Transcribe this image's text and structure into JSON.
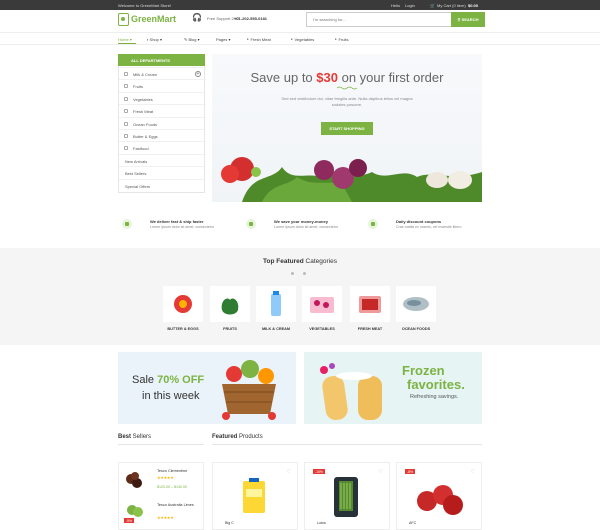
{
  "topbar": {
    "welcome": "Welcome to GreenMart Store!",
    "hello": "Hello",
    "login": "Login",
    "cart": "My Cart (0 item)",
    "cart_total": "$0.00"
  },
  "header": {
    "logo": "GreenMart",
    "support_label": "Free Support 24/7",
    "support_phone": "+01-202-555-0181",
    "search_placeholder": "I'm searching for...",
    "search_button": "SEARCH"
  },
  "nav": {
    "items": [
      "Home ▾",
      "Shop ▾",
      "Blog ▾",
      "Pages ▾",
      "Fresh Meat",
      "Vegetables",
      "Fruits"
    ]
  },
  "sidebar": {
    "header": "ALL DEPARTMENTS",
    "items": [
      "Milk & Cream",
      "Fruits",
      "Vegetables",
      "Fresh Meat",
      "Ocean Foods",
      "Butter & Eggs",
      "Fastfood"
    ],
    "links": [
      "New Arrivals",
      "Best Sellers",
      "Special Offers"
    ]
  },
  "hero": {
    "title_pre": "Save up to ",
    "title_highlight": "$30",
    "title_post": " on your first order",
    "text": "Sed sed vestibulum dui, vitae fringilla ante. Nulla dapibus tellus vel magna sodales posuere.",
    "button": "START SHOPPING"
  },
  "features": [
    {
      "title": "We deliver fast & ship faster",
      "sub": "Lorem ipsum dolor sit amet, consectetur"
    },
    {
      "title": "We save your money-money",
      "sub": "Lorem ipsum dolor sit amet, consectetur"
    },
    {
      "title": "Daily discount coupons",
      "sub": "Cras mattis ex mauris, vel molestie libero"
    }
  ],
  "categories": {
    "title_bold": "Top Featured",
    "title_rest": " Categories",
    "items": [
      "BUTTER & EGGS",
      "FRUITS",
      "MILK & CREAM",
      "VEGETABLES",
      "FRESH MEAT",
      "OCEAN FOODS"
    ]
  },
  "banners": {
    "sale_pre": "Sale ",
    "sale_pct": "70% OFF",
    "sale_line2": "in this week",
    "frozen_1": "Frozen",
    "frozen_2": "favorites.",
    "frozen_3": "Refreshing savings."
  },
  "best_sellers": {
    "title_bold": "Best",
    "title_rest": " Sellers",
    "items": [
      {
        "name": "Tesco Clementine",
        "stars": "★★★★★",
        "price": "$120.00 – $140.00"
      },
      {
        "name": "Tesco Australia Limes",
        "stars": "★★★★★",
        "badge": "-5%"
      }
    ]
  },
  "featured": {
    "title_bold": "Featured",
    "title_rest": " Products",
    "items": [
      {
        "name": "Big C",
        "badge": ""
      },
      {
        "name": "Lotus",
        "badge": "-15%"
      },
      {
        "name": "AFC",
        "badge": "-8%"
      }
    ]
  },
  "colors": {
    "accent": "#7cb342",
    "sale": "#e53935",
    "topbar": "#3a3a3a"
  }
}
